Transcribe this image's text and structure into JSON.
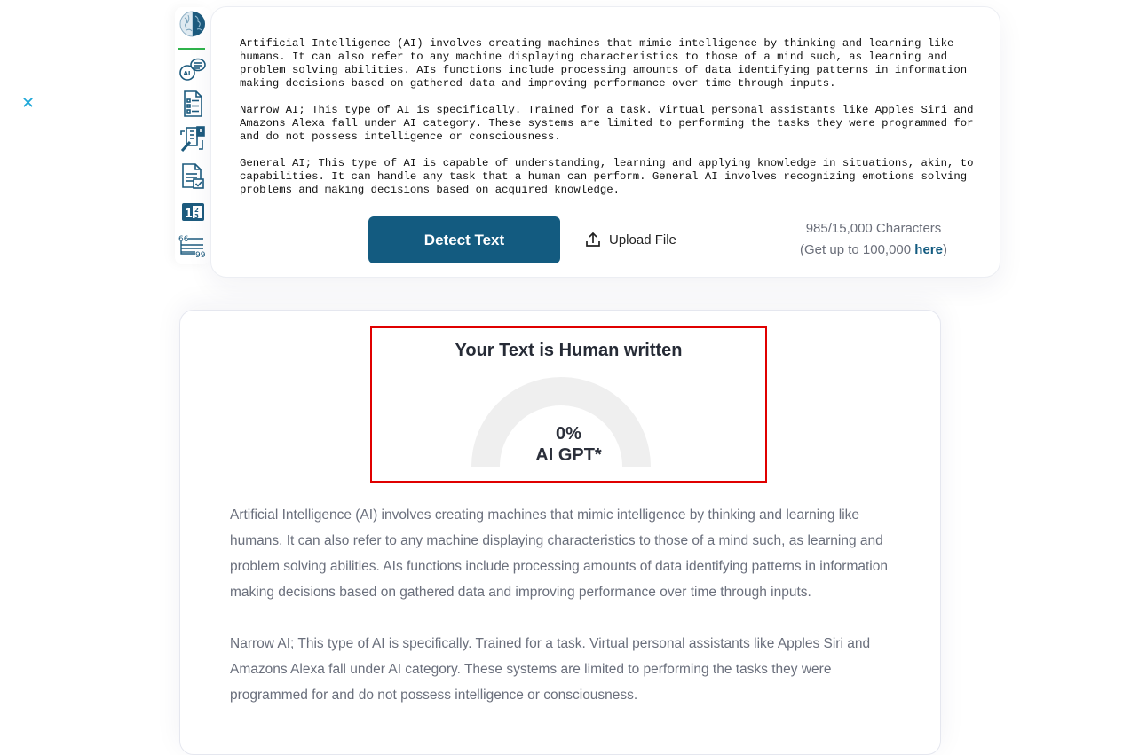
{
  "overlay": {
    "close_icon": "close-icon"
  },
  "sidebar": {
    "items": [
      {
        "name": "brain-logo",
        "icon": "brain-icon"
      },
      {
        "name": "ai-chat",
        "icon": "ai-chat-icon"
      },
      {
        "name": "document-list",
        "icon": "document-list-icon"
      },
      {
        "name": "plagiarism-check",
        "icon": "plagiarism-icon"
      },
      {
        "name": "document-check",
        "icon": "document-check-icon"
      },
      {
        "name": "fraction-calculator",
        "icon": "fraction-icon"
      },
      {
        "name": "citation",
        "icon": "quote-icon"
      }
    ]
  },
  "input": {
    "paragraphs": [
      "Artificial Intelligence (AI) involves creating machines that mimic intelligence by thinking and learning like humans. It can also refer to any machine displaying characteristics to those of a mind such, as learning and problem solving abilities. AIs functions include processing amounts of data identifying patterns in information making decisions based on gathered data and improving performance over time through inputs.",
      "Narrow AI; This type of AI is specifically. Trained for a task. Virtual personal assistants like Apples Siri and Amazons Alexa fall under AI category. These systems are limited to performing the tasks they were programmed for and do not possess intelligence or consciousness.",
      "General AI; This type of AI is capable of understanding, learning and applying knowledge in situations, akin, to capabilities. It can handle any task that a human can perform. General AI involves recognizing emotions solving problems and making decisions based on acquired knowledge."
    ],
    "detect_button": "Detect Text",
    "upload_button": "Upload File",
    "char_count": "985/15,000 Characters",
    "upgrade_prefix": "(Get up to 100,000 ",
    "upgrade_link": "here",
    "upgrade_suffix": ")"
  },
  "result": {
    "title": "Your Text is Human written",
    "ai_percent": 0,
    "ai_percent_label": "0%",
    "gauge_label": "AI GPT*",
    "colors": {
      "track": "#efefef",
      "fill": "#135b80",
      "highlight_border": "#e00000"
    },
    "paragraphs": [
      "Artificial Intelligence (AI) involves creating machines that mimic intelligence by thinking and learning like humans. It can also refer to any machine displaying characteristics to those of a mind such, as learning and problem solving abilities. AIs functions include processing amounts of data identifying patterns in information making decisions based on gathered data and improving performance over time through inputs.",
      "Narrow AI; This type of AI is specifically. Trained for a task. Virtual personal assistants like Apples Siri and Amazons Alexa fall under AI category. These systems are limited to performing the tasks they were programmed for and do not possess intelligence or consciousness."
    ]
  }
}
